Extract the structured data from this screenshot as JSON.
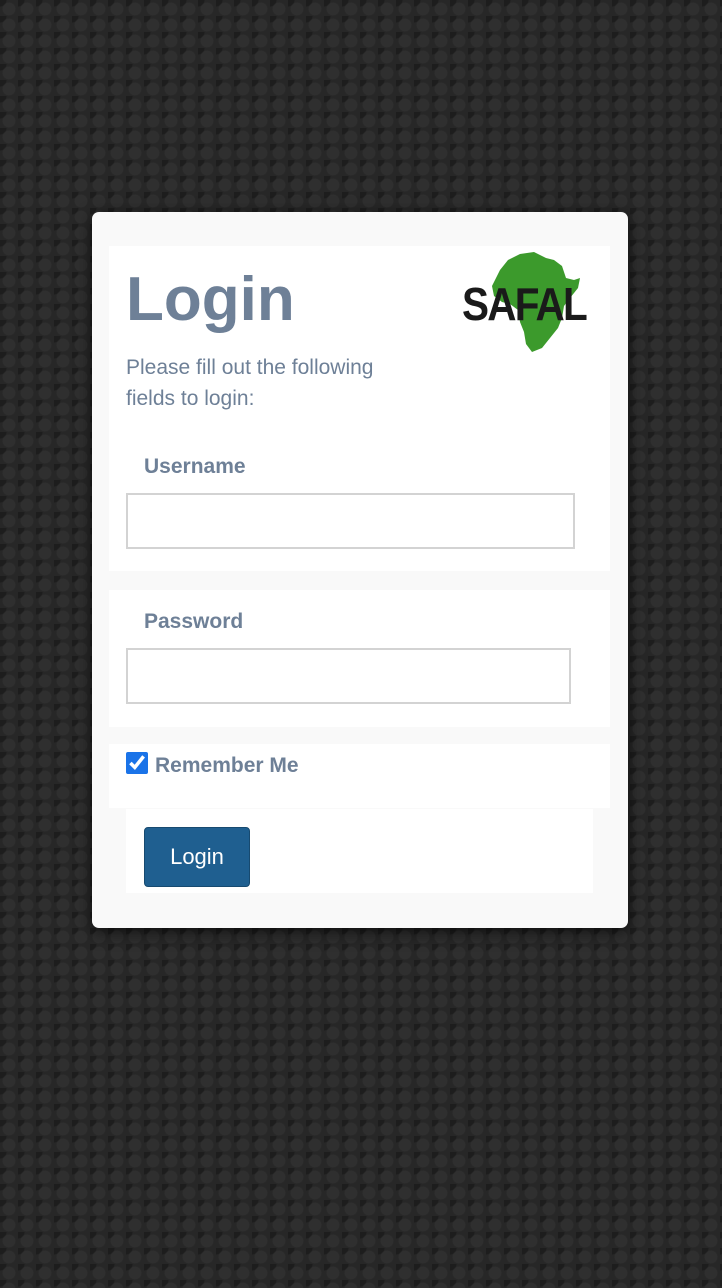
{
  "login_card": {
    "title": "Login",
    "subtitle": "Please fill out the following fields to login:",
    "logo": {
      "text": "SAFAL",
      "icon": "africa-map-logo",
      "color_green": "#3c9a2c",
      "color_black": "#1a1a1a"
    },
    "username": {
      "label": "Username",
      "value": "",
      "placeholder": ""
    },
    "password": {
      "label": "Password",
      "value": "",
      "placeholder": ""
    },
    "remember_me": {
      "label": "Remember Me",
      "checked": true
    },
    "submit_label": "Login"
  },
  "colors": {
    "background": "#272727",
    "card": "#f9f9f9",
    "text": "#6e8097",
    "button": "#1f5f90",
    "checkbox": "#1a73e8"
  }
}
